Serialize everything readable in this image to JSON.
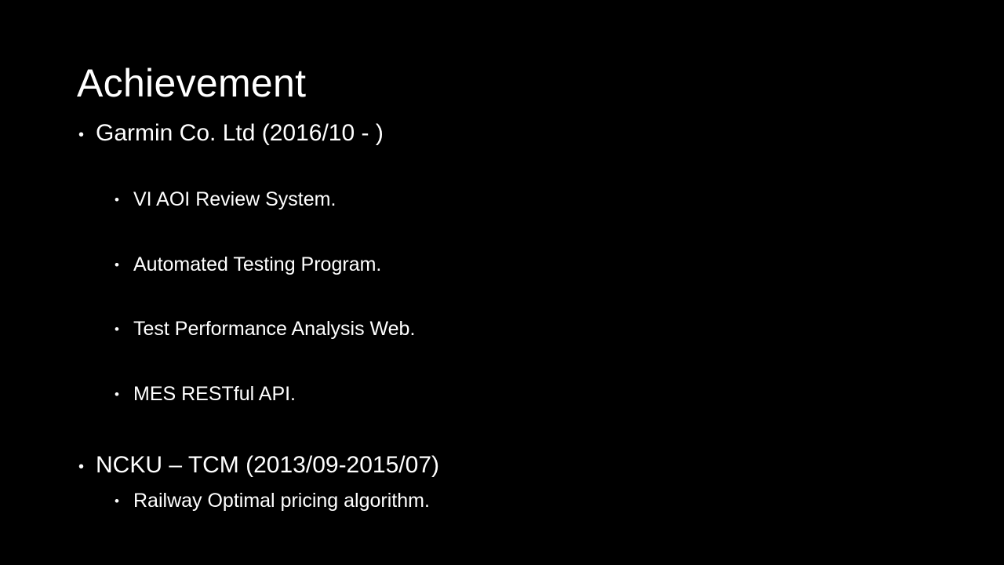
{
  "slide": {
    "title": "Achievement",
    "sections": [
      {
        "heading": "Garmin Co. Ltd (2016/10 - )",
        "items": [
          "VI AOI Review System.",
          "Automated Testing Program.",
          "Test Performance Analysis Web.",
          "MES RESTful API."
        ]
      },
      {
        "heading": "NCKU – TCM (2013/09-2015/07)",
        "items": [
          "Railway Optimal pricing algorithm."
        ]
      }
    ],
    "bullet_char": "•",
    "colors": {
      "background": "#000000",
      "text": "#ffffff"
    }
  }
}
